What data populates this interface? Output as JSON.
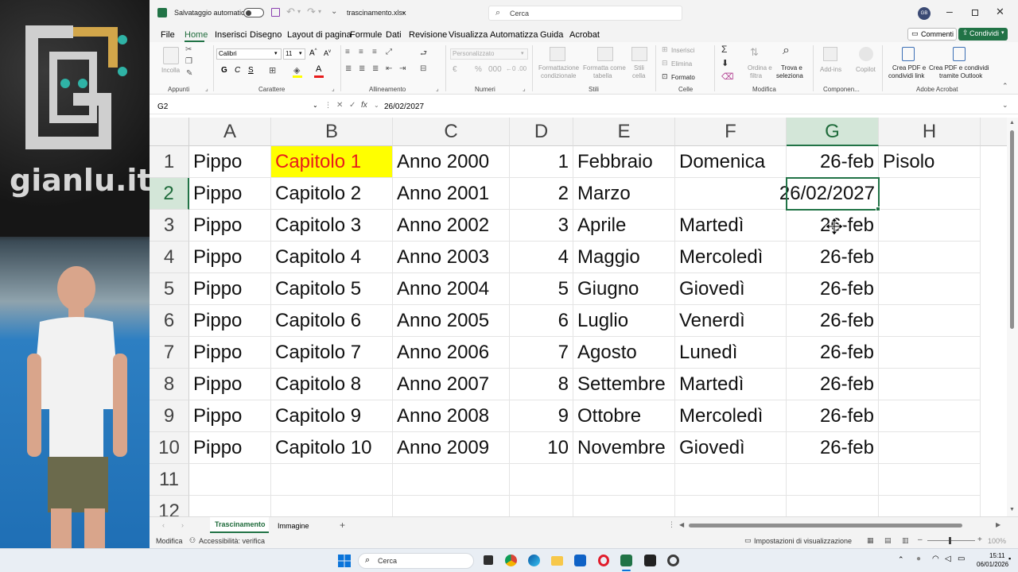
{
  "window": {
    "autosave_label": "Salvataggio automatico",
    "filename": "trascinamento.xlsx",
    "search_placeholder": "Cerca",
    "user_initials": "GB"
  },
  "overlay": {
    "logo_text": "gianlu.it"
  },
  "menu": {
    "tabs": [
      "File",
      "Home",
      "Inserisci",
      "Disegno",
      "Layout di pagina",
      "Formule",
      "Dati",
      "Revisione",
      "Visualizza",
      "Automatizza",
      "Guida",
      "Acrobat"
    ],
    "active_tab": "Home",
    "comments_label": "Commenti",
    "share_label": "Condividi"
  },
  "ribbon": {
    "groups": {
      "clipboard": "Appunti",
      "font": "Carattere",
      "alignment": "Allineamento",
      "number": "Numeri",
      "styles": "Stili",
      "cells": "Celle",
      "editing": "Modifica",
      "addins": "Componen...",
      "acrobat": "Adobe Acrobat"
    },
    "paste_label": "Incolla",
    "font_name": "Calibri",
    "font_size": "11",
    "number_format": "Personalizzato",
    "cond_format_label_1": "Formattazione",
    "cond_format_label_2": "condizionale",
    "format_table_label_1": "Formatta come",
    "format_table_label_2": "tabella",
    "cell_styles_label_1": "Stili",
    "cell_styles_label_2": "cella",
    "insert_label": "Inserisci",
    "delete_label": "Elimina",
    "format_label": "Formato",
    "sort_label_1": "Ordina e",
    "sort_label_2": "filtra",
    "find_label_1": "Trova e",
    "find_label_2": "seleziona",
    "addins_label": "Add-ins",
    "copilot_label": "Copilot",
    "pdf_link_label_1": "Crea PDF e",
    "pdf_link_label_2": "condividi link",
    "pdf_outlook_label_1": "Crea PDF e condividi",
    "pdf_outlook_label_2": "tramite Outlook"
  },
  "formula_bar": {
    "name_box": "G2",
    "formula": "26/02/2027"
  },
  "sheet": {
    "columns": [
      "A",
      "B",
      "C",
      "D",
      "E",
      "F",
      "G",
      "H"
    ],
    "rows": [
      [
        "Pippo",
        "Capitolo 1",
        "Anno 2000",
        "1",
        "Febbraio",
        "Domenica",
        "26-feb",
        "Pisolo"
      ],
      [
        "Pippo",
        "Capitolo 2",
        "Anno 2001",
        "2",
        "Marzo",
        "",
        "26/02/2027",
        ""
      ],
      [
        "Pippo",
        "Capitolo 3",
        "Anno 2002",
        "3",
        "Aprile",
        "Martedì",
        "26-feb",
        ""
      ],
      [
        "Pippo",
        "Capitolo 4",
        "Anno 2003",
        "4",
        "Maggio",
        "Mercoledì",
        "26-feb",
        ""
      ],
      [
        "Pippo",
        "Capitolo 5",
        "Anno 2004",
        "5",
        "Giugno",
        "Giovedì",
        "26-feb",
        ""
      ],
      [
        "Pippo",
        "Capitolo 6",
        "Anno 2005",
        "6",
        "Luglio",
        "Venerdì",
        "26-feb",
        ""
      ],
      [
        "Pippo",
        "Capitolo 7",
        "Anno 2006",
        "7",
        "Agosto",
        "Lunedì",
        "26-feb",
        ""
      ],
      [
        "Pippo",
        "Capitolo 8",
        "Anno 2007",
        "8",
        "Settembre",
        "Martedì",
        "26-feb",
        ""
      ],
      [
        "Pippo",
        "Capitolo 9",
        "Anno 2008",
        "9",
        "Ottobre",
        "Mercoledì",
        "26-feb",
        ""
      ],
      [
        "Pippo",
        "Capitolo 10",
        "Anno 2009",
        "10",
        "Novembre",
        "Giovedì",
        "26-feb",
        ""
      ],
      [
        "",
        "",
        "",
        "",
        "",
        "",
        "",
        ""
      ],
      [
        "",
        "",
        "",
        "",
        "",
        "",
        "",
        ""
      ]
    ],
    "row_numbers": [
      "1",
      "2",
      "3",
      "4",
      "5",
      "6",
      "7",
      "8",
      "9",
      "10",
      "11",
      "12"
    ],
    "active_cell": "G2",
    "highlight_cell": "B1",
    "highlight_colors": {
      "fill": "#ffff00",
      "text": "#e81c1c"
    }
  },
  "sheet_tabs": {
    "tabs": [
      "Trascinamento",
      "Immagine"
    ],
    "active": "Trascinamento"
  },
  "status": {
    "mode": "Modifica",
    "accessibility": "Accessibilità: verifica",
    "display_settings": "Impostazioni di visualizzazione",
    "zoom": "100%"
  },
  "taskbar": {
    "search_label": "Cerca",
    "time": "15:11",
    "date": "06/01/2026"
  },
  "colors": {
    "excel_green": "#217346",
    "accent": "#1f6b3b"
  }
}
